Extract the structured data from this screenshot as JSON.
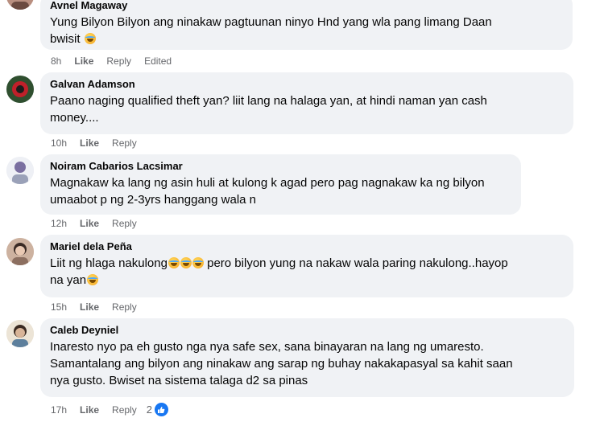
{
  "comments": [
    {
      "author": "Avnel Magaway",
      "lines": [
        "Yung Bilyon Bilyon ang ninakaw pagtuunan ninyo Hnd yang wla pang limang Daan",
        "bwisit"
      ],
      "time": "8h",
      "like": "Like",
      "reply": "Reply",
      "edited": "Edited"
    },
    {
      "author": "Galvan Adamson",
      "lines": [
        "Paano naging qualified theft yan? liit lang na halaga yan, at hindi naman yan cash",
        "money...."
      ],
      "time": "10h",
      "like": "Like",
      "reply": "Reply"
    },
    {
      "author": "Noiram Cabarios Lacsimar",
      "lines": [
        "Magnakaw ka lang ng asin huli at kulong k agad pero pag nagnakaw ka ng bilyon",
        "umaabot p ng 2-3yrs hanggang wala n"
      ],
      "time": "12h",
      "like": "Like",
      "reply": "Reply"
    },
    {
      "author": "Mariel dela Peña",
      "line1_a": "Liit ng hlaga nakulong",
      "line1_b": " pero bilyon yung na nakaw wala paring nakulong..hayop",
      "line2": "na yan",
      "time": "15h",
      "like": "Like",
      "reply": "Reply"
    },
    {
      "author": "Caleb Deyniel",
      "lines": [
        "Inaresto nyo pa eh gusto nga nya safe sex, sana binayaran na lang ng umaresto.",
        "Samantalang ang bilyon ang ninakaw ang sarap ng buhay nakakapasyal sa kahit saan",
        "nya gusto. Bwiset na sistema talaga d2 sa pinas"
      ],
      "time": "17h",
      "like": "Like",
      "reply": "Reply",
      "reaction_count": "2"
    }
  ],
  "icons": {
    "emoji": "laughing-crying-emoji",
    "reaction": "like-reaction-icon"
  },
  "colors": {
    "bubble": "#f0f2f5",
    "meta_text": "#65676b",
    "like_blue": "#1877f2"
  }
}
